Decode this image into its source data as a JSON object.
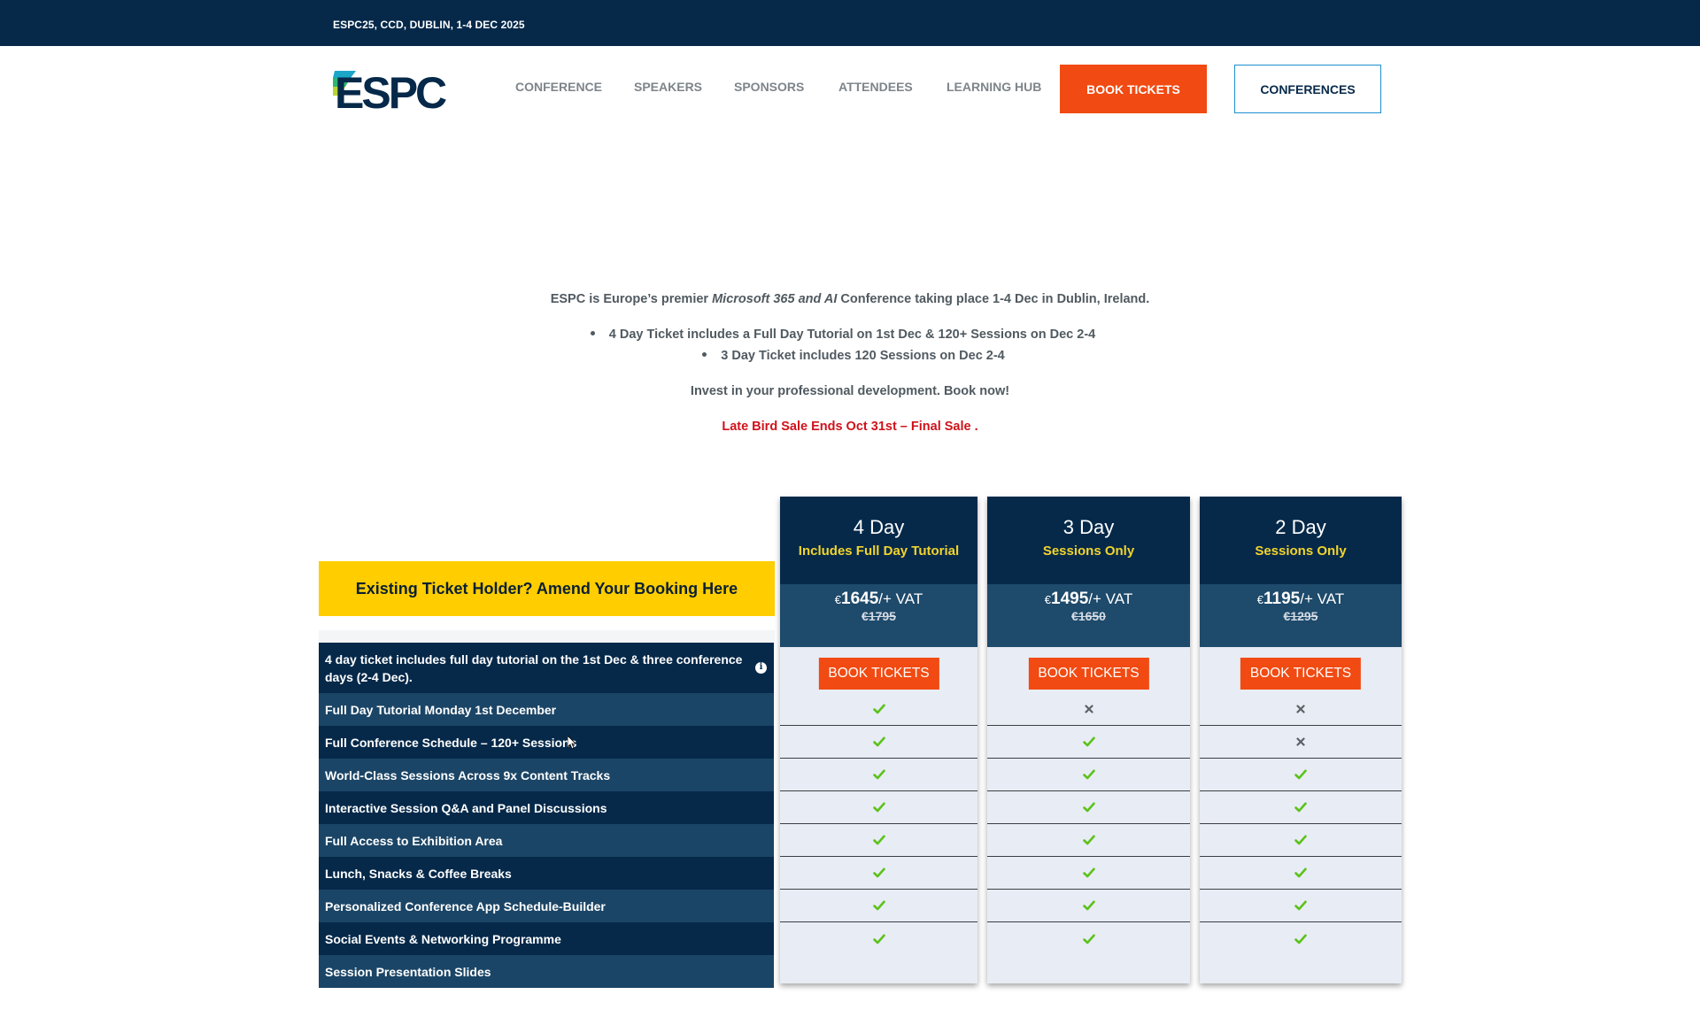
{
  "topbar": {
    "event": "ESPC25, CCD, DUBLIN, 1-4 DEC 2025"
  },
  "logo": {
    "text": "ESPC"
  },
  "nav": {
    "items": [
      "CONFERENCE",
      "SPEAKERS",
      "SPONSORS",
      "ATTENDEES",
      "LEARNING HUB"
    ],
    "book_label": "BOOK TICKETS",
    "conferences_label": "CONFERENCES"
  },
  "intro": {
    "line1_a": "ESPC is Europe’s premier ",
    "line1_em": "Microsoft 365 and AI",
    "line1_b": " Conference taking place 1-4 Dec in Dublin, Ireland.",
    "bullets": [
      "4 Day Ticket includes a Full Day Tutorial on 1st Dec & 120+ Sessions on Dec 2-4",
      "3 Day Ticket includes 120 Sessions on Dec 2-4"
    ],
    "invest": "Invest in your professional development. Book now!",
    "sale": "Late Bird Sale Ends Oct 31st – Final Sale ."
  },
  "amend_label": "Existing Ticket Holder? Amend Your Booking Here",
  "features": [
    "4 day ticket includes full day tutorial on the 1st Dec & three conference days (2-4 Dec).",
    "Full Day Tutorial Monday 1st December",
    "Full Conference Schedule – 120+ Sessions",
    "World-Class Sessions Across 9x Content Tracks",
    "Interactive Session Q&A and Panel Discussions",
    "Full Access to Exhibition Area",
    "Lunch, Snacks & Coffee Breaks",
    "Personalized Conference App Schedule-Builder",
    "Social Events & Networking Programme",
    "Session Presentation Slides"
  ],
  "plans": [
    {
      "name": "4 Day",
      "subtitle": "Includes Full Day Tutorial",
      "currency": "€",
      "price": "1645",
      "vat": "/+ VAT",
      "was": "€1795",
      "book_label": "BOOK TICKETS",
      "marks": [
        "check",
        "check",
        "check",
        "check",
        "check",
        "check",
        "check",
        "check"
      ]
    },
    {
      "name": "3 Day",
      "subtitle": "Sessions Only",
      "currency": "€",
      "price": "1495",
      "vat": "/+ VAT",
      "was": "€1650",
      "book_label": "BOOK TICKETS",
      "marks": [
        "cross",
        "check",
        "check",
        "check",
        "check",
        "check",
        "check",
        "check"
      ]
    },
    {
      "name": "2 Day",
      "subtitle": "Sessions Only",
      "currency": "€",
      "price": "1195",
      "vat": "/+ VAT",
      "was": "€1295",
      "book_label": "BOOK TICKETS",
      "marks": [
        "cross",
        "cross",
        "check",
        "check",
        "check",
        "check",
        "check",
        "check"
      ]
    }
  ],
  "colors": {
    "navy": "#06294a",
    "navy_mid": "#1b4566",
    "accent_orange": "#f14a12",
    "amend_yellow": "#ffcd00",
    "subtitle_yellow": "#f2d42b",
    "sale_red": "#d0121b",
    "check_green": "#5cc21b",
    "cross_gray": "#5b6166"
  },
  "icons": {
    "check": "check-icon",
    "cross": "cross-icon",
    "info": "info-icon",
    "cursor": "mouse-cursor-icon"
  }
}
